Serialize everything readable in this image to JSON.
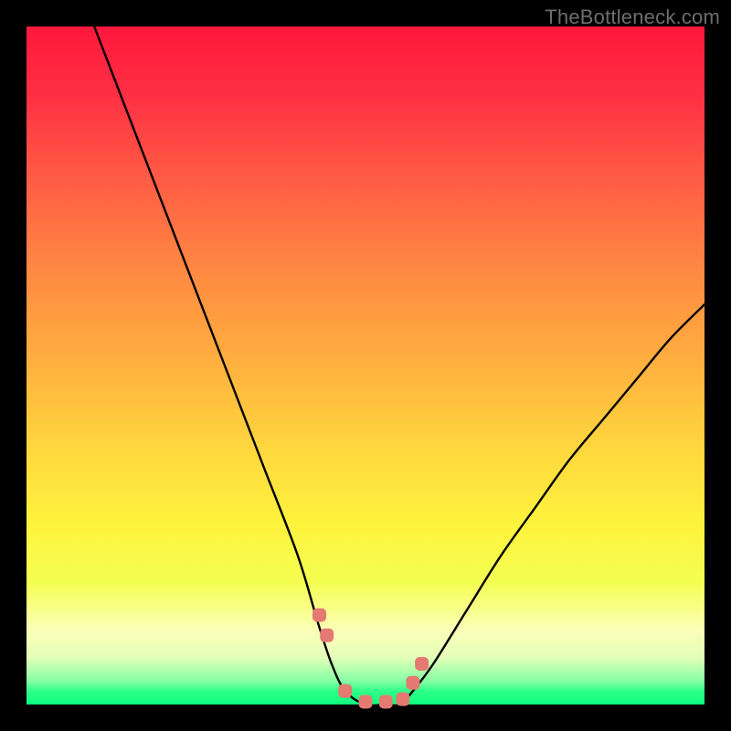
{
  "watermark": "TheBottleneck.com",
  "chart_data": {
    "type": "line",
    "title": "",
    "xlabel": "",
    "ylabel": "",
    "xlim": [
      0,
      100
    ],
    "ylim": [
      0,
      100
    ],
    "series": [
      {
        "name": "curve",
        "x": [
          10,
          15,
          20,
          25,
          30,
          35,
          40,
          43,
          45,
          47,
          50,
          53,
          55,
          57,
          60,
          65,
          70,
          75,
          80,
          85,
          90,
          95,
          100
        ],
        "y": [
          100,
          87,
          74,
          61,
          48,
          35,
          22,
          12,
          6,
          2,
          0,
          0,
          0,
          2,
          6,
          14,
          22,
          29,
          36,
          42,
          48,
          54,
          59
        ]
      }
    ],
    "markers": {
      "name": "highlight-points",
      "color": "#e47a72",
      "x": [
        43.2,
        44.3,
        47.0,
        50.0,
        53.0,
        55.5,
        57.0,
        58.3
      ],
      "y": [
        13.2,
        10.2,
        2.0,
        0.4,
        0.4,
        0.8,
        3.2,
        6.0
      ]
    },
    "gradient_stops": [
      {
        "pos": 0.0,
        "color": "#ff183d"
      },
      {
        "pos": 0.1,
        "color": "#ff2f43"
      },
      {
        "pos": 0.22,
        "color": "#ff5a45"
      },
      {
        "pos": 0.35,
        "color": "#ff8642"
      },
      {
        "pos": 0.5,
        "color": "#ffb13f"
      },
      {
        "pos": 0.62,
        "color": "#ffd63e"
      },
      {
        "pos": 0.73,
        "color": "#fff23d"
      },
      {
        "pos": 0.82,
        "color": "#f4ff52"
      },
      {
        "pos": 0.89,
        "color": "#fbffb6"
      },
      {
        "pos": 0.93,
        "color": "#e4ffb9"
      },
      {
        "pos": 0.965,
        "color": "#87ffa4"
      },
      {
        "pos": 0.98,
        "color": "#2fff88"
      },
      {
        "pos": 1.0,
        "color": "#0dff7f"
      }
    ]
  }
}
